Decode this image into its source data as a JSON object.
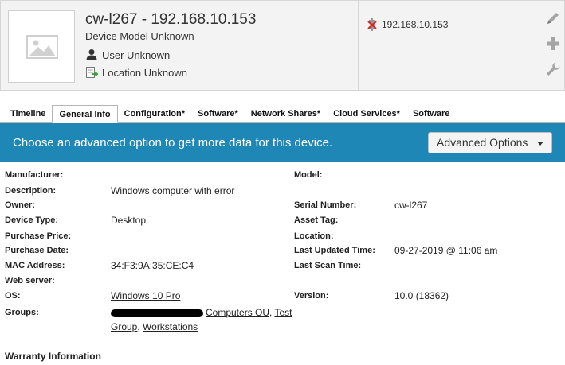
{
  "header": {
    "title": "cw-l267 - 192.168.10.153",
    "model": "Device Model Unknown",
    "user": "User Unknown",
    "location": "Location Unknown",
    "ip": "192.168.10.153"
  },
  "tabs": [
    {
      "label": "Timeline",
      "active": false
    },
    {
      "label": "General Info",
      "active": true
    },
    {
      "label": "Configuration*",
      "active": false
    },
    {
      "label": "Software*",
      "active": false
    },
    {
      "label": "Network Shares*",
      "active": false
    },
    {
      "label": "Cloud Services*",
      "active": false
    },
    {
      "label": "Software",
      "active": false
    }
  ],
  "banner": {
    "text": "Choose an advanced option to get more data for this device.",
    "button_label": "Advanced Options"
  },
  "details": {
    "manufacturer_label": "Manufacturer:",
    "manufacturer": "",
    "description_label": "Description:",
    "description": "Windows computer with error",
    "owner_label": "Owner:",
    "owner": "",
    "device_type_label": "Device Type:",
    "device_type": "Desktop",
    "purchase_price_label": "Purchase Price:",
    "purchase_price": "",
    "purchase_date_label": "Purchase Date:",
    "purchase_date": "",
    "mac_label": "MAC Address:",
    "mac": "34:F3:9A:35:CE:C4",
    "web_server_label": "Web server:",
    "web_server": "",
    "os_label": "OS:",
    "os": "Windows 10 Pro",
    "groups_label": "Groups:",
    "groups": [
      "Computers OU",
      "Test Group",
      "Workstations"
    ],
    "model_label": "Model:",
    "model": "",
    "serial_label": "Serial Number:",
    "serial": "cw-l267",
    "asset_tag_label": "Asset Tag:",
    "asset_tag": "",
    "location_label": "Location:",
    "location": "",
    "last_updated_label": "Last Updated Time:",
    "last_updated": "09-27-2019 @ 11:06 am",
    "last_scan_label": "Last Scan Time:",
    "last_scan": "",
    "version_label": "Version:",
    "version": "10.0 (18362)"
  },
  "warranty": {
    "heading": "Warranty Information"
  },
  "colors": {
    "banner": "#1f87b5",
    "header_bg": "#f3f3f3"
  }
}
